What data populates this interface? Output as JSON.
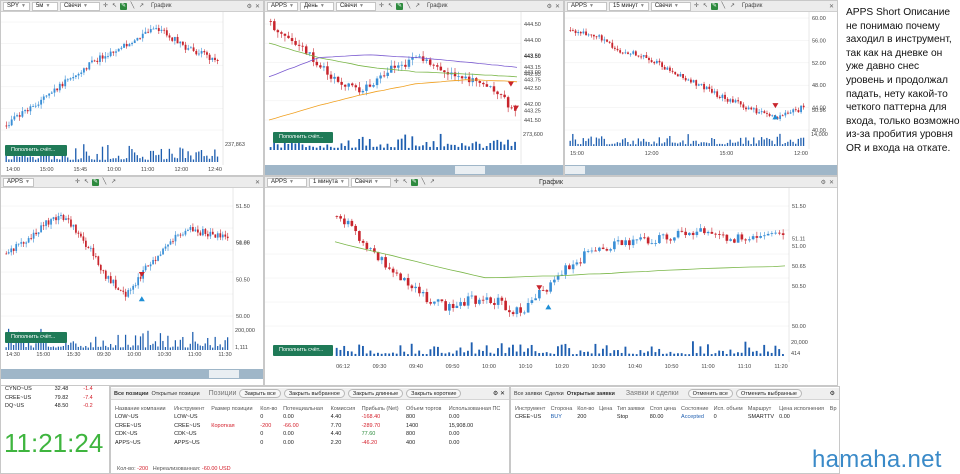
{
  "charts": [
    {
      "id": "c1",
      "symbol": "SPY",
      "interval": "5м",
      "type": "Свечи",
      "label": "График",
      "price_ticks": [],
      "time_ticks": [
        "14:00",
        "15:00",
        "15:45",
        "10:00",
        "11:00",
        "12:00",
        "12:40"
      ],
      "vol_label": "237,863",
      "button": "Пополнить счёт..."
    },
    {
      "id": "c2",
      "symbol": "APPS",
      "interval": "День",
      "type": "Свечи",
      "label": "График",
      "price_ticks": [
        "444.50",
        "444.00",
        "443.50",
        "443.00",
        "442.50",
        "442.00",
        "441.50"
      ],
      "price_tags": [
        "443.59",
        "443.15",
        "442.93",
        "443.75",
        "443.25"
      ],
      "time_ticks": [],
      "vol_label": "273,600",
      "button": "Пополнить счёт..."
    },
    {
      "id": "c3",
      "symbol": "APPS",
      "interval": "15 минут",
      "type": "Свечи",
      "label": "График",
      "price_ticks": [
        "60.00",
        "56.00",
        "52.00",
        "48.00",
        "44.00",
        "40.00"
      ],
      "price_tags": [
        "50.96"
      ],
      "time_ticks": [
        "15:00",
        "12:00",
        "15:00",
        "12:00"
      ],
      "vol_label": "14,000"
    },
    {
      "id": "c4",
      "symbol": "APPS",
      "interval": "",
      "type": "",
      "label": "",
      "price_ticks": [
        "51.50",
        "51.00",
        "50.50",
        "50.00"
      ],
      "price_tags": [
        "50.85"
      ],
      "time_ticks": [
        "14:30",
        "15:00",
        "15:30",
        "09:30",
        "10:00",
        "10:30",
        "11:00",
        "11:30"
      ],
      "vol_label": "200,000",
      "vol_label2": "1,111",
      "button": "Пополнить счёт..."
    },
    {
      "id": "c5",
      "symbol": "APPS",
      "interval": "1 минута",
      "type": "Свечи",
      "label": "График",
      "price_ticks": [
        "51.50",
        "51.00",
        "50.50",
        "50.00"
      ],
      "price_tags": [
        "51.11",
        "50.65"
      ],
      "time_ticks": [
        "06:12",
        "09:30",
        "09:40",
        "09:50",
        "10:00",
        "10:10",
        "10:20",
        "10:30",
        "10:40",
        "10:50",
        "11:00",
        "11:10",
        "11:20"
      ],
      "vol_label": "20,000",
      "vol_label2": "414",
      "button": "Пополнить счёт..."
    }
  ],
  "watchlist": [
    {
      "sym": "CYNO~US",
      "price": "32.48",
      "chg": "-1.4"
    },
    {
      "sym": "CREE~US",
      "price": "79.82",
      "chg": "-7.4"
    },
    {
      "sym": "DQ~US",
      "price": "48.50",
      "chg": "-0.2"
    }
  ],
  "clock": "11:21:24",
  "positions": {
    "tabs": [
      "Все позиции",
      "Открытые позиции"
    ],
    "title": "Позиции",
    "buttons": [
      "Закрыть все",
      "Закрыть выбранное",
      "Закрыть длинные",
      "Закрыть короткие"
    ],
    "columns": [
      "Название компании",
      "Инструмент",
      "Размер позиции",
      "Кол-во",
      "Потенциальная",
      "Комиссия",
      "Прибыль (Net)",
      "Объем торгов",
      "Использованная ПС"
    ],
    "rows": [
      {
        "name": "LOW~US",
        "sym": "LOW~US",
        "side": "",
        "qty": "0",
        "pot": "0.00",
        "comm": "4.40",
        "pnl": "-168.40",
        "vol": "800",
        "used": "0.00"
      },
      {
        "name": "CREE~US",
        "sym": "CREE~US",
        "side": "Короткая",
        "qty": "-200",
        "pot": "-66.00",
        "comm": "7.70",
        "pnl": "-289.70",
        "vol": "1400",
        "used": "15,908.00"
      },
      {
        "name": "CDK~US",
        "sym": "CDK~US",
        "side": "",
        "qty": "0",
        "pot": "0.00",
        "comm": "4.40",
        "pnl": "77.60",
        "vol": "800",
        "used": "0.00"
      },
      {
        "name": "APPS~US",
        "sym": "APPS~US",
        "side": "",
        "qty": "0",
        "pot": "0.00",
        "comm": "2.20",
        "pnl": "-46.20",
        "vol": "400",
        "used": "0.00"
      }
    ],
    "footer_label": "Кол-во:",
    "footer_qty": "-200",
    "footer_label2": "Нереализованная:",
    "footer_value": "-60.00 USD"
  },
  "orders": {
    "tabs": [
      "Все заявки",
      "Сделки",
      "Открытые заявки"
    ],
    "title": "Заявки и сделки",
    "buttons": [
      "Отменить все",
      "Отменить выбранные"
    ],
    "columns": [
      "Инструмент",
      "Сторона",
      "Кол-во",
      "Цена",
      "Тип заявки",
      "Стоп цена",
      "Состояние",
      "Исп. объем",
      "Маршрут",
      "Цена исполнения",
      "Вр"
    ],
    "rows": [
      {
        "sym": "CREE~US",
        "side": "BUY",
        "qty": "200",
        "price": "",
        "type": "Stop",
        "stop": "80.00",
        "state": "Accepted",
        "filled": "0",
        "route": "SMARTTV",
        "exec": "0.00"
      }
    ]
  },
  "notes": "APPS Short Описание не понимаю почему заходил в инструмент, так как на дневке он уже давно снес уровень и продолжал падать, нету какой-то четкого паттерна для входа, только возможно из-за пробития уровня OR и входа на откате.",
  "watermark": "hamaha.net",
  "colors": {
    "up": "#3a8fd6",
    "down": "#c8242c",
    "vol": "#1f5fb0",
    "ema_green": "#7ab648",
    "ema_purple": "#7a5ad0",
    "ema_orange": "#f0a020",
    "button": "#1f7a57",
    "clock": "#3fb53f",
    "watermark": "#3a8ac8"
  }
}
